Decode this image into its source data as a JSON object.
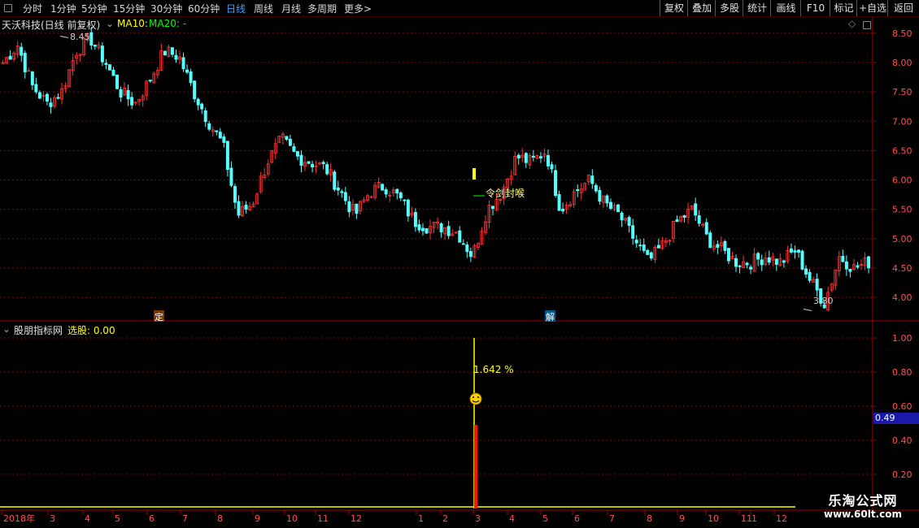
{
  "toolbar": {
    "periods": [
      "分时",
      "1分钟",
      "5分钟",
      "15分钟",
      "30分钟",
      "60分钟",
      "日线",
      "周线",
      "月线",
      "多周期",
      "更多"
    ],
    "more_arrow": ">",
    "active_period": "日线",
    "right_buttons": [
      "复权",
      "叠加",
      "多股",
      "统计",
      "画线",
      "F10",
      "标记",
      "+自选",
      "返回"
    ]
  },
  "main_panel": {
    "title": "天沃科技(日线 前复权)",
    "ma10_label": "MA10:",
    "ma20_label": "MA20: -",
    "high_label": "8.45",
    "low_label": "3.80",
    "annotation": "令剑封喉",
    "marker_ding": "定",
    "marker_jie": "解",
    "y_ticks": [
      "8.50",
      "8.00",
      "7.50",
      "7.00",
      "6.50",
      "6.00",
      "5.50",
      "5.00",
      "4.50",
      "4.00"
    ]
  },
  "sub_panel": {
    "title": "股朋指标网",
    "value_label": "选股: 0.00",
    "percent_label": "1.642 %",
    "y_ticks": [
      "1.00",
      "0.80",
      "0.60",
      "0.40",
      "0.20"
    ],
    "current_value": "0.49"
  },
  "x_axis": {
    "labels": [
      "2018年",
      "3",
      "4",
      "5",
      "6",
      "7",
      "8",
      "9",
      "10",
      "11",
      "12",
      "1",
      "2",
      "3",
      "4",
      "5",
      "6",
      "7",
      "8",
      "9",
      "10",
      "11",
      "12",
      "1"
    ]
  },
  "brand": {
    "name": "乐淘公式网",
    "url": "www.60lt.com"
  },
  "colors": {
    "up": "#ff3232",
    "down": "#54ffff",
    "grid": "#8b0000",
    "ma10": "#ffff00",
    "ma20": "#00ff00",
    "axis": "#a00000"
  },
  "chart_data": {
    "type": "candlestick",
    "price_range": [
      3.6,
      8.65
    ],
    "price_ticks": [
      8.5,
      8.0,
      7.5,
      7.0,
      6.5,
      6.0,
      5.5,
      5.0,
      4.5,
      4.0
    ],
    "period": "2018-01 to 2020-01",
    "highest": 8.45,
    "lowest": 3.8,
    "closes_approx": [
      8.0,
      8.3,
      7.6,
      7.3,
      7.5,
      8.2,
      8.4,
      8.0,
      7.5,
      7.3,
      7.7,
      8.2,
      8.1,
      7.5,
      7.0,
      6.6,
      5.4,
      5.6,
      6.3,
      6.7,
      6.4,
      6.3,
      6.2,
      5.8,
      5.4,
      5.8,
      5.9,
      5.7,
      5.3,
      5.2,
      5.2,
      5.1,
      4.7,
      5.5,
      5.8,
      6.4,
      6.3,
      6.5,
      5.5,
      5.8,
      6.0,
      5.6,
      5.4,
      5.0,
      4.6,
      4.9,
      5.3,
      5.5,
      5.0,
      4.8,
      4.6,
      4.6,
      4.7,
      4.6,
      4.8,
      4.3,
      3.9,
      4.7,
      4.5,
      4.6
    ],
    "indicator": {
      "name": "选股",
      "y_range": [
        0,
        1.0
      ],
      "spike_value": 0.49,
      "spike_percent_label": "1.642 %"
    }
  }
}
